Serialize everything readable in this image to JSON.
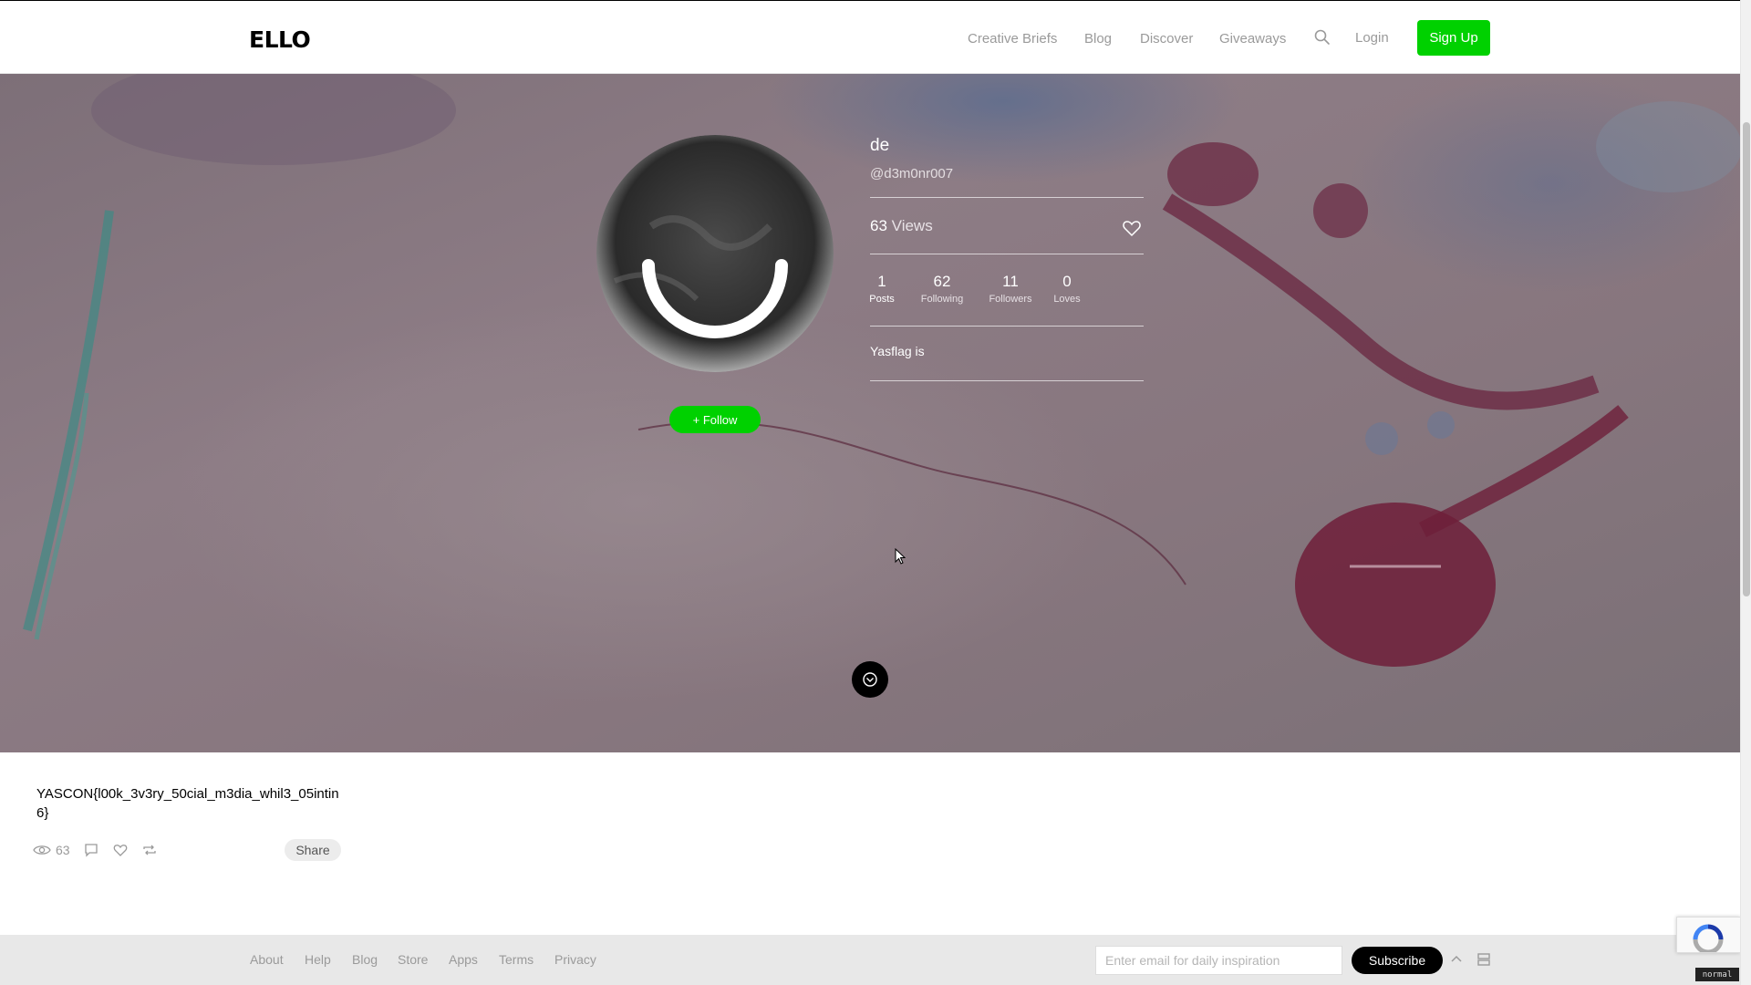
{
  "nav": {
    "logo": "ELLO",
    "links": [
      "Creative Briefs",
      "Blog",
      "Discover",
      "Giveaways"
    ],
    "login": "Login",
    "signup": "Sign Up"
  },
  "profile": {
    "name": "de",
    "handle": "@d3m0nr007",
    "views_count": "63",
    "views_label": "Views",
    "stats": [
      {
        "num": "1",
        "label": "Posts"
      },
      {
        "num": "62",
        "label": "Following"
      },
      {
        "num": "11",
        "label": "Followers"
      },
      {
        "num": "0",
        "label": "Loves"
      }
    ],
    "bio": "Yasflag is",
    "follow_label": "+ Follow"
  },
  "post": {
    "text": "YASCON{l00k_3v3ry_50cial_m3dia_whil3_05intin6}",
    "views": "63",
    "share_label": "Share"
  },
  "footer": {
    "links": [
      "About",
      "Help",
      "Blog",
      "Store",
      "Apps",
      "Terms",
      "Privacy"
    ],
    "email_placeholder": "Enter email for daily inspiration",
    "subscribe_label": "Subscribe"
  },
  "mode_badge": "normal",
  "colors": {
    "accent_green": "#00d100",
    "text_gray": "#9a9a9a"
  },
  "icons": [
    "search-icon",
    "heart-icon",
    "chevron-down-icon",
    "eye-icon",
    "comment-icon",
    "repost-icon",
    "arrow-up-icon",
    "grid-icon"
  ]
}
